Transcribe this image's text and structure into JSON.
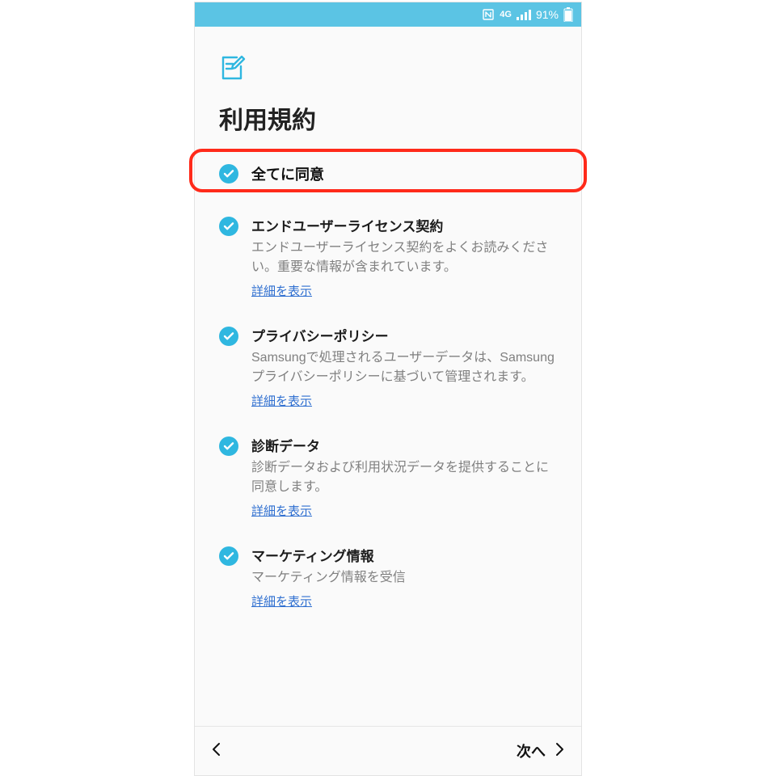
{
  "status": {
    "network_label": "4G",
    "battery_pct": "91%",
    "icons": {
      "nfc": "nfc-icon",
      "signal": "signal-icon",
      "battery": "battery-icon"
    }
  },
  "header": {
    "title": "利用規約",
    "icon": "document-pencil-icon"
  },
  "agree_all": {
    "label": "全てに同意",
    "checked": true,
    "highlighted": true
  },
  "items": [
    {
      "title": "エンドユーザーライセンス契約",
      "desc": "エンドユーザーライセンス契約をよくお読みください。重要な情報が含まれています。",
      "link": "詳細を表示",
      "checked": true
    },
    {
      "title": "プライバシーポリシー",
      "desc": "Samsungで処理されるユーザーデータは、Samsungプライバシーポリシーに基づいて管理されます。",
      "link": "詳細を表示",
      "checked": true
    },
    {
      "title": "診断データ",
      "desc": "診断データおよび利用状況データを提供することに同意します。",
      "link": "詳細を表示",
      "checked": true
    },
    {
      "title": "マーケティング情報",
      "desc": "マーケティング情報を受信",
      "link": "詳細を表示",
      "checked": true
    }
  ],
  "footer": {
    "back": "",
    "next": "次へ"
  },
  "colors": {
    "accent": "#2fb7e0",
    "link": "#2f6fd0",
    "highlight": "#ff2a1a"
  }
}
